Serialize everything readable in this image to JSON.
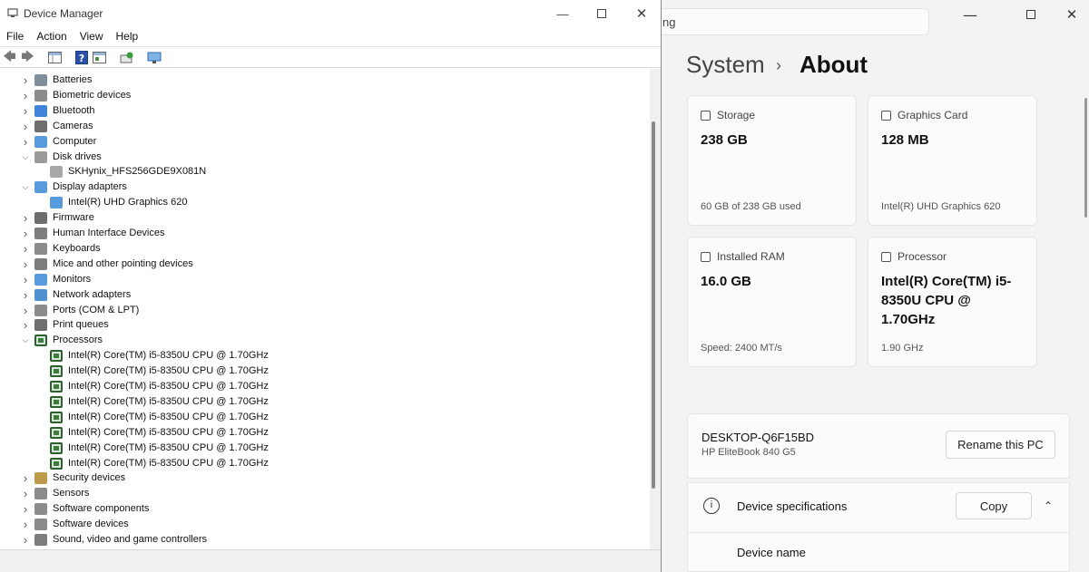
{
  "settings": {
    "search_value": "ng",
    "breadcrumb": {
      "parent": "System",
      "separator": "›",
      "current": "About"
    },
    "cards": [
      {
        "icon": "storage-icon",
        "title": "Storage",
        "value": "238 GB",
        "sub": "60 GB of 238 GB used"
      },
      {
        "icon": "graphics-card-icon",
        "title": "Graphics Card",
        "value": "128 MB",
        "sub": "Intel(R) UHD Graphics 620"
      },
      {
        "icon": "ram-icon",
        "title": "Installed RAM",
        "value": "16.0 GB",
        "sub": "Speed: 2400 MT/s"
      },
      {
        "icon": "processor-icon",
        "title": "Processor",
        "value": "Intel(R) Core(TM) i5-8350U CPU @ 1.70GHz",
        "sub": "1.90 GHz"
      }
    ],
    "pc_name": "DESKTOP-Q6F15BD",
    "pc_model": "HP EliteBook 840 G5",
    "rename_button": "Rename this PC",
    "specs": {
      "title": "Device specifications",
      "copy_button": "Copy",
      "device_name_label": "Device name",
      "device_name_value": "DESKTOP-Q6F15BD"
    }
  },
  "device_manager": {
    "title": "Device Manager",
    "menu": [
      "File",
      "Action",
      "View",
      "Help"
    ],
    "tree": [
      {
        "label": "Batteries",
        "expanded": false,
        "icon": "battery-icon",
        "color": "#6b7b8c"
      },
      {
        "label": "Biometric devices",
        "expanded": false,
        "icon": "fingerprint-icon",
        "color": "#777777"
      },
      {
        "label": "Bluetooth",
        "expanded": false,
        "icon": "bluetooth-icon",
        "color": "#1f6fd1"
      },
      {
        "label": "Cameras",
        "expanded": false,
        "icon": "camera-icon",
        "color": "#555555"
      },
      {
        "label": "Computer",
        "expanded": false,
        "icon": "computer-icon",
        "color": "#3a8ad6"
      },
      {
        "label": "Disk drives",
        "expanded": true,
        "icon": "disk-drive-icon",
        "color": "#888888"
      },
      {
        "label": "SKHynix_HFS256GDE9X081N",
        "child": true,
        "icon": "disk-icon",
        "color": "#999999"
      },
      {
        "label": "Display adapters",
        "expanded": true,
        "icon": "display-adapter-icon",
        "color": "#3a8ad6"
      },
      {
        "label": "Intel(R) UHD Graphics 620",
        "child": true,
        "icon": "display-icon",
        "color": "#3a8ad6"
      },
      {
        "label": "Firmware",
        "expanded": false,
        "icon": "firmware-icon",
        "color": "#555555"
      },
      {
        "label": "Human Interface Devices",
        "expanded": false,
        "icon": "hid-icon",
        "color": "#666666"
      },
      {
        "label": "Keyboards",
        "expanded": false,
        "icon": "keyboard-icon",
        "color": "#777777"
      },
      {
        "label": "Mice and other pointing devices",
        "expanded": false,
        "icon": "mouse-icon",
        "color": "#666666"
      },
      {
        "label": "Monitors",
        "expanded": false,
        "icon": "monitor-icon",
        "color": "#3a8ad6"
      },
      {
        "label": "Network adapters",
        "expanded": false,
        "icon": "network-icon",
        "color": "#2f7cc8"
      },
      {
        "label": "Ports (COM & LPT)",
        "expanded": false,
        "icon": "port-icon",
        "color": "#777777"
      },
      {
        "label": "Print queues",
        "expanded": false,
        "icon": "printer-icon",
        "color": "#555555"
      },
      {
        "label": "Processors",
        "expanded": true,
        "icon": "processor-icon",
        "color": "#3e7a3e"
      },
      {
        "label": "Intel(R) Core(TM) i5-8350U CPU @ 1.70GHz",
        "child": true,
        "icon": "cpu-icon",
        "color": "#3e7a3e"
      },
      {
        "label": "Intel(R) Core(TM) i5-8350U CPU @ 1.70GHz",
        "child": true,
        "icon": "cpu-icon",
        "color": "#3e7a3e"
      },
      {
        "label": "Intel(R) Core(TM) i5-8350U CPU @ 1.70GHz",
        "child": true,
        "icon": "cpu-icon",
        "color": "#3e7a3e"
      },
      {
        "label": "Intel(R) Core(TM) i5-8350U CPU @ 1.70GHz",
        "child": true,
        "icon": "cpu-icon",
        "color": "#3e7a3e"
      },
      {
        "label": "Intel(R) Core(TM) i5-8350U CPU @ 1.70GHz",
        "child": true,
        "icon": "cpu-icon",
        "color": "#3e7a3e"
      },
      {
        "label": "Intel(R) Core(TM) i5-8350U CPU @ 1.70GHz",
        "child": true,
        "icon": "cpu-icon",
        "color": "#3e7a3e"
      },
      {
        "label": "Intel(R) Core(TM) i5-8350U CPU @ 1.70GHz",
        "child": true,
        "icon": "cpu-icon",
        "color": "#3e7a3e"
      },
      {
        "label": "Intel(R) Core(TM) i5-8350U CPU @ 1.70GHz",
        "child": true,
        "icon": "cpu-icon",
        "color": "#3e7a3e"
      },
      {
        "label": "Security devices",
        "expanded": false,
        "icon": "security-key-icon",
        "color": "#b08a2a"
      },
      {
        "label": "Sensors",
        "expanded": false,
        "icon": "sensor-icon",
        "color": "#777777"
      },
      {
        "label": "Software components",
        "expanded": false,
        "icon": "software-component-icon",
        "color": "#777777"
      },
      {
        "label": "Software devices",
        "expanded": false,
        "icon": "software-device-icon",
        "color": "#777777"
      },
      {
        "label": "Sound, video and game controllers",
        "expanded": false,
        "icon": "speaker-icon",
        "color": "#666666"
      }
    ]
  }
}
